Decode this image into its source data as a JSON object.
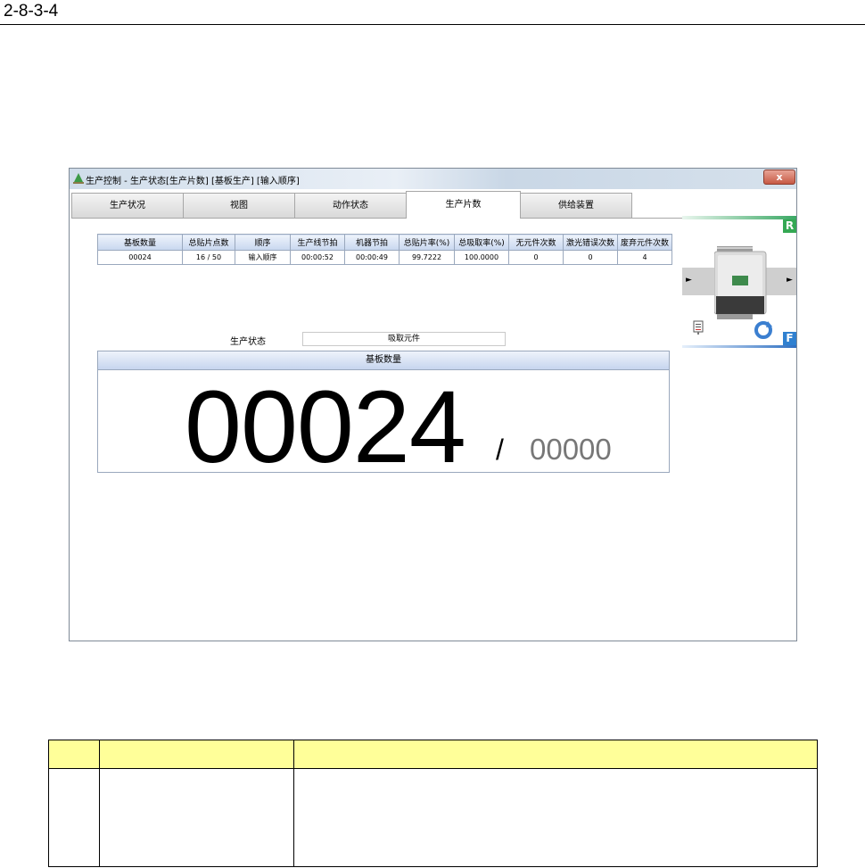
{
  "doc_header": {
    "section_number": "2-8-3-4"
  },
  "window": {
    "title": "生产控制 - 生产状态[生产片数] [基板生产] [输入顺序]",
    "close_glyph": "x"
  },
  "tabs": [
    {
      "label": "生产状况",
      "active": false
    },
    {
      "label": "视图",
      "active": false
    },
    {
      "label": "动作状态",
      "active": false
    },
    {
      "label": "生产片数",
      "active": true
    },
    {
      "label": "供给装置",
      "active": false
    }
  ],
  "stats_table": {
    "headers": [
      "基板数量",
      "总贴片点数",
      "顺序",
      "生产线节拍",
      "机器节拍",
      "总贴片率(%)",
      "总吸取率(%)",
      "无元件次数",
      "激光错误次数",
      "废弃元件次数"
    ],
    "row": [
      "00024",
      "16 / 50",
      "输入顺序",
      "00:00:52",
      "00:00:49",
      "99.7222",
      "100.0000",
      "0",
      "0",
      "4"
    ]
  },
  "status": {
    "label": "生产状态",
    "value": "吸取元件"
  },
  "board_panel": {
    "header": "基板数量",
    "count": "00024",
    "slash": "/",
    "total": "00000"
  },
  "machine_panel": {
    "rear_label": "R",
    "front_label": "F",
    "arrow_left": "►",
    "arrow_right": "►",
    "colors": {
      "rear": "#34a853",
      "front": "#2f80d0"
    }
  }
}
